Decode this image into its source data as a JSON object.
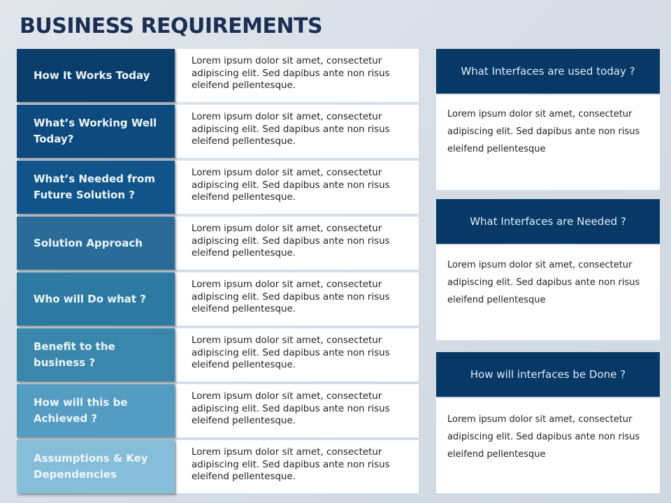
{
  "title": "BUSINESS REQUIREMENTS",
  "rows": [
    {
      "label": "How It Works Today",
      "text": "Lorem ipsum dolor sit amet, consectetur adipiscing elit. Sed dapibus ante non risus eleifend pellentesque.",
      "color": "#0b3d6b"
    },
    {
      "label": "What’s Working Well Today?",
      "text": "Lorem ipsum dolor sit amet, consectetur adipiscing elit. Sed dapibus ante non risus eleifend pellentesque.",
      "color": "#0e4a7d"
    },
    {
      "label": "What’s Needed from Future Solution ?",
      "text": "Lorem ipsum dolor sit amet, consectetur adipiscing elit. Sed dapibus ante non risus eleifend pellentesque.",
      "color": "#105489"
    },
    {
      "label": "Solution Approach",
      "text": "Lorem ipsum dolor sit amet, consectetur adipiscing elit. Sed dapibus ante non risus eleifend pellentesque.",
      "color": "#2a6b98"
    },
    {
      "label": "Who will Do what ?",
      "text": "Lorem ipsum dolor sit amet, consectetur adipiscing elit. Sed dapibus ante non risus eleifend pellentesque.",
      "color": "#2c7aa1"
    },
    {
      "label": "Benefit to the business ?",
      "text": "Lorem ipsum dolor sit amet, consectetur adipiscing elit. Sed dapibus ante non risus eleifend pellentesque.",
      "color": "#3b86ab"
    },
    {
      "label": "How will this be Achieved ?",
      "text": "Lorem ipsum dolor sit amet, consectetur adipiscing elit. Sed dapibus ante non risus eleifend pellentesque.",
      "color": "#559cc2"
    },
    {
      "label": "Assumptions & Key Dependencies",
      "text": "Lorem ipsum dolor sit amet, consectetur adipiscing elit. Sed dapibus ante non risus eleifend pellentesque.",
      "color": "#86bdd8"
    }
  ],
  "panels": [
    {
      "title": "What Interfaces are used today ?",
      "text": "Lorem ipsum dolor sit amet, consectetur adipiscing elit. Sed dapibus ante non risus eleifend pellentesque"
    },
    {
      "title": "What Interfaces are Needed ?",
      "text": "Lorem ipsum dolor sit amet, consectetur adipiscing elit. Sed dapibus ante non risus eleifend pellentesque"
    },
    {
      "title": "How will interfaces be Done ?",
      "text": "Lorem ipsum dolor sit amet, consectetur adipiscing elit. Sed dapibus ante non risus eleifend pellentesque"
    }
  ]
}
